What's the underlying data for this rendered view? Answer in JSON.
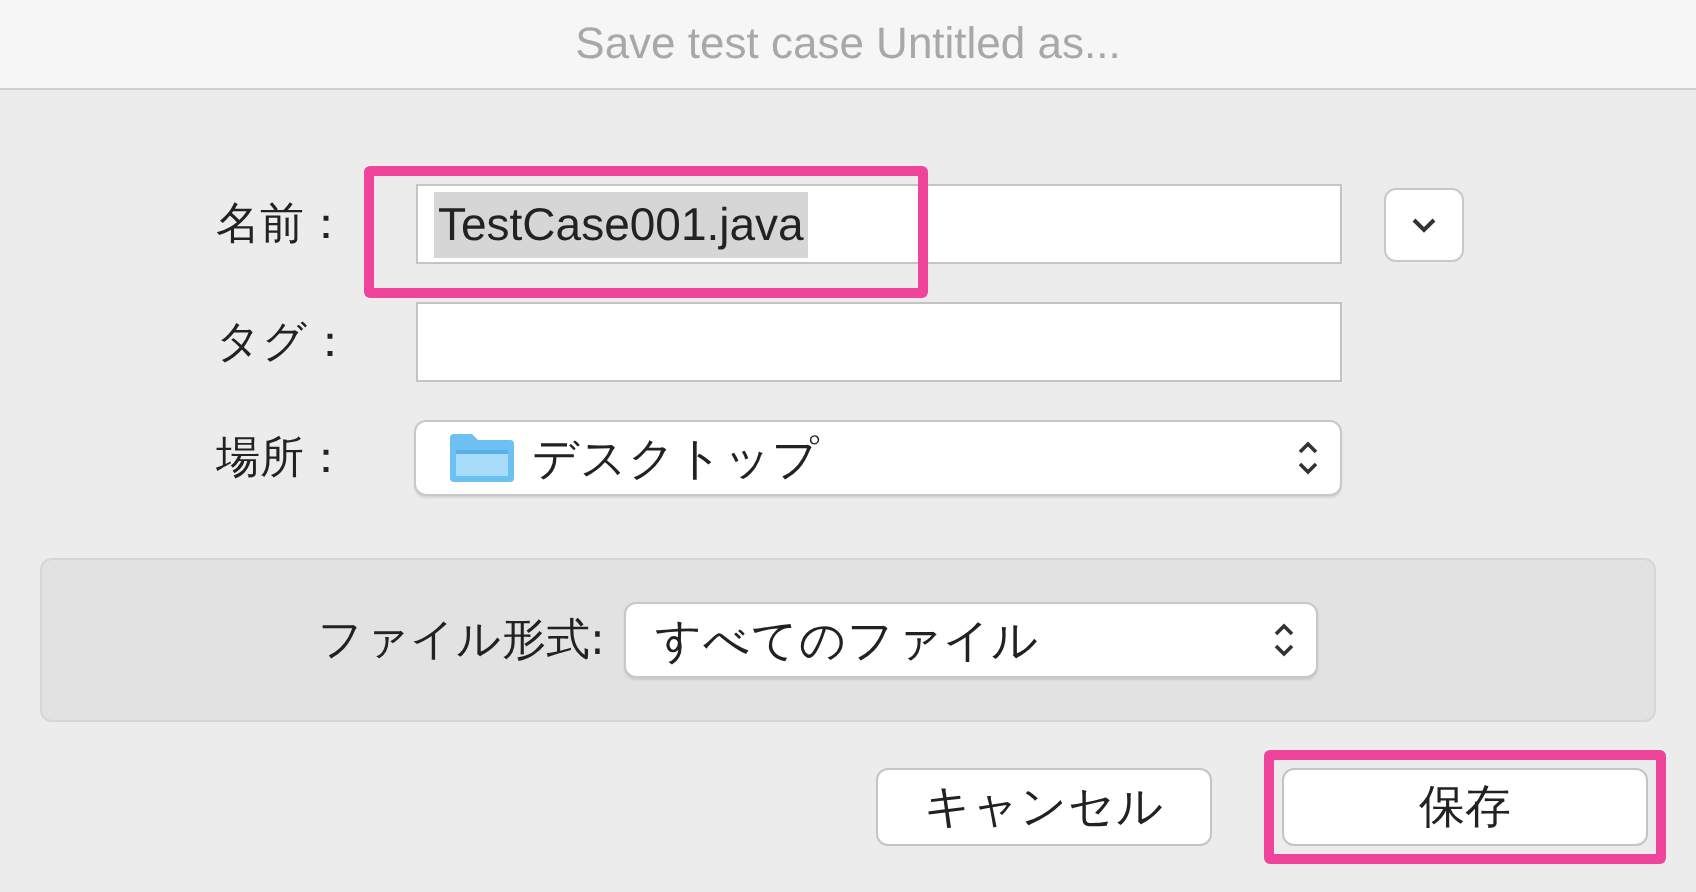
{
  "window": {
    "title": "Save test case Untitled as..."
  },
  "name_field": {
    "label": "名前：",
    "value": "TestCase001.java",
    "text_selected": true,
    "highlighted": true
  },
  "tags_field": {
    "label": "タグ："
  },
  "location": {
    "label": "場所：",
    "value": "デスクトップ"
  },
  "format": {
    "label": "ファイル形式:",
    "value": "すべてのファイル"
  },
  "buttons": [
    {
      "label": "キャンセル",
      "kind": "cancel",
      "highlighted": false
    },
    {
      "label": "保存",
      "kind": "default",
      "highlighted": true
    }
  ]
}
